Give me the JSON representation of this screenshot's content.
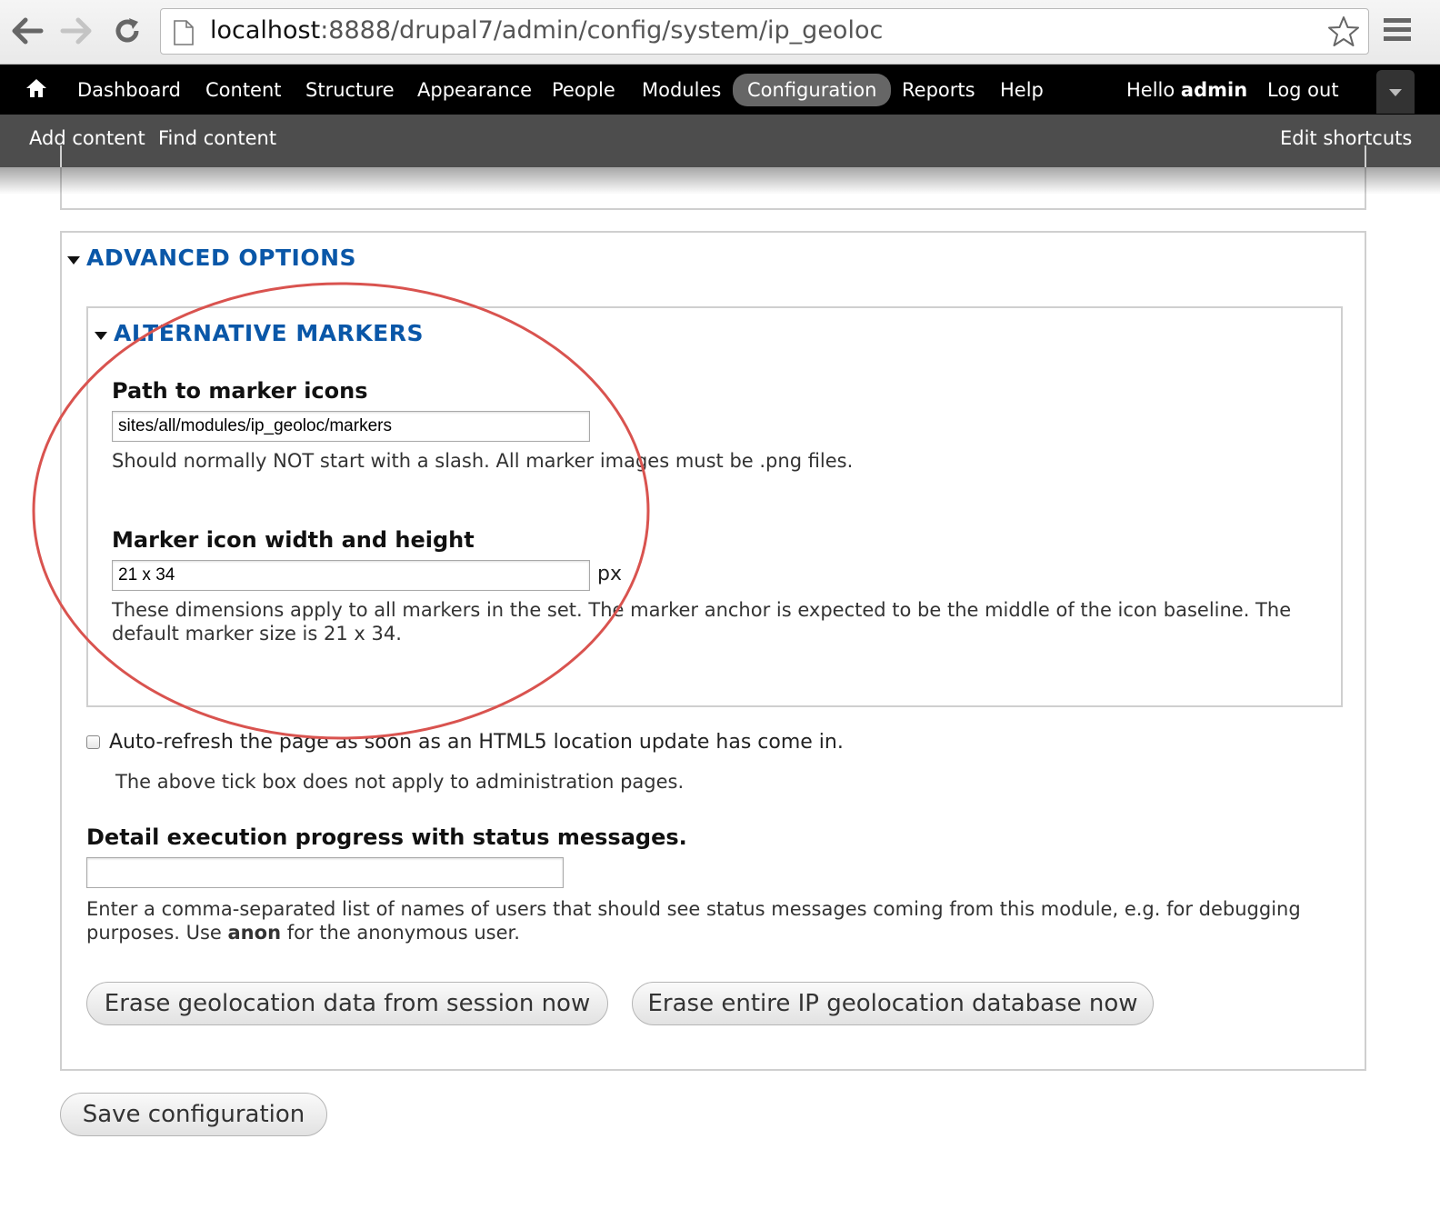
{
  "browser": {
    "url_host": "localhost",
    "url_path": ":8888/drupal7/admin/config/system/ip_geoloc"
  },
  "toolbar": {
    "items": [
      "Dashboard",
      "Content",
      "Structure",
      "Appearance",
      "People",
      "Modules",
      "Configuration",
      "Reports",
      "Help"
    ],
    "active": "Configuration",
    "hello_prefix": "Hello ",
    "hello_user": "admin",
    "logout": "Log out"
  },
  "shortcuts": {
    "add_content": "Add content",
    "find_content": "Find content",
    "edit_shortcuts": "Edit shortcuts"
  },
  "advanced": {
    "legend": "ADVANCED OPTIONS",
    "alternative": {
      "legend": "ALTERNATIVE MARKERS",
      "path_label": "Path to marker icons",
      "path_value": "sites/all/modules/ip_geoloc/markers",
      "path_desc": "Should normally NOT start with a slash. All marker images must be .png files.",
      "size_label": "Marker icon width and height",
      "size_value": "21 x 34",
      "size_suffix": "px",
      "size_desc": "These dimensions apply to all markers in the set. The marker anchor is expected to be the middle of the icon baseline. The default marker size is 21 x 34."
    },
    "autorefresh_label": "Auto-refresh the page as soon as an HTML5 location update has come in.",
    "autorefresh_checked": false,
    "autorefresh_desc": "The above tick box does not apply to administration pages.",
    "debug_label": "Detail execution progress with status messages.",
    "debug_value": "",
    "debug_desc_1": "Enter a comma-separated list of names of users that should see status messages coming from this module, e.g. for debugging purposes. Use ",
    "debug_desc_bold": "anon",
    "debug_desc_2": " for the anonymous user.",
    "erase_session_button": "Erase geolocation data from session now",
    "erase_db_button": "Erase entire IP geolocation database now"
  },
  "save_button": "Save configuration",
  "colors": {
    "legend_blue": "#0a57a8",
    "highlight_red": "#d9534f",
    "toolbar_black": "#000000",
    "shortcut_gray": "#4d4d4d"
  }
}
